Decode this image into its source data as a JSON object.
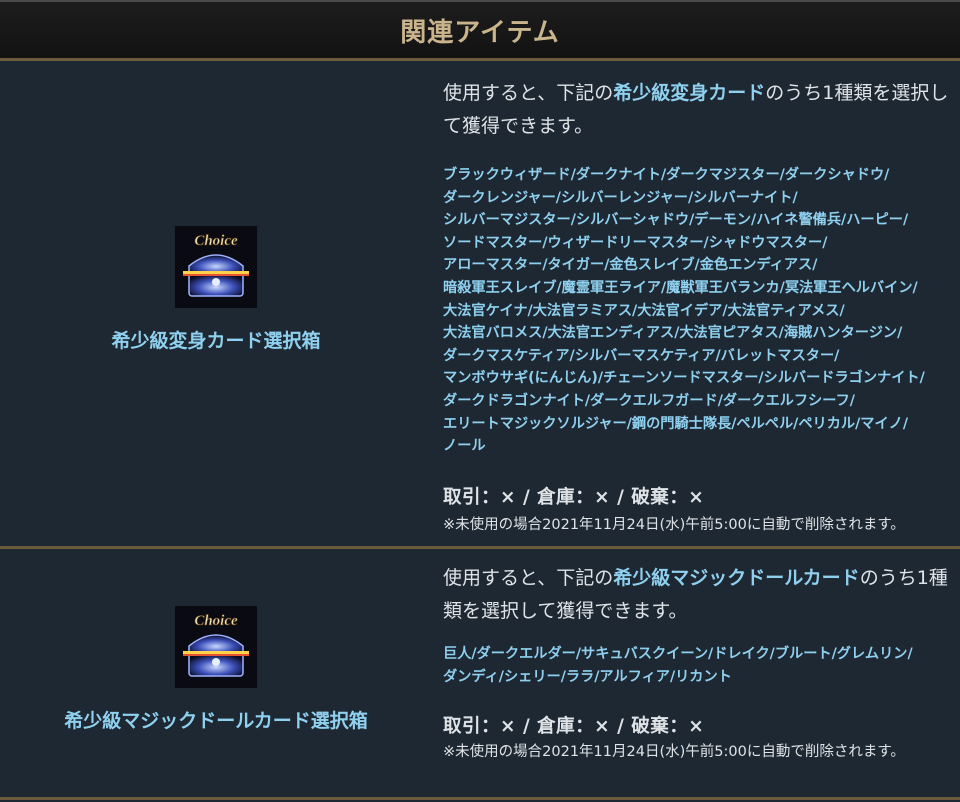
{
  "header": {
    "title": "関連アイテム"
  },
  "items": [
    {
      "badge": "Choice",
      "name": "希少級変身カード選択箱",
      "desc_pre": "使用すると、下記の",
      "desc_hl": "希少級変身カード",
      "desc_post": "のうち1種類を選択して獲得できます。",
      "list_lines": [
        "ブラックウィザード/ダークナイト/ダークマジスター/ダークシャドウ/",
        "ダークレンジャー/シルバーレンジャー/シルバーナイト/",
        "シルバーマジスター/シルバーシャドウ/デーモン/ハイネ警備兵/ハーピー/",
        "ソードマスター/ウィザードリーマスター/シャドウマスター/",
        "アローマスター/タイガー/金色スレイブ/金色エンディアス/",
        "暗殺軍王スレイブ/魔霊軍王ライア/魔獣軍王バランカ/冥法軍王ヘルバイン/",
        "大法官ケイナ/大法官ラミアス/大法官イデア/大法官ティアメス/",
        "大法官バロメス/大法官エンディアス/大法官ピアタス/海賊ハンタージン/",
        "ダークマスケティア/シルバーマスケティア/バレットマスター/",
        "マンボウサギ(にんじん)/チェーンソードマスター/シルバードラゴンナイト/",
        "ダークドラゴンナイト/ダークエルフガード/ダークエルフシーフ/",
        "エリートマジックソルジャー/鋼の門騎士隊長/ペルペル/ペリカル/マイノ/",
        "ノール"
      ],
      "trade": "取引：× / 倉庫：× / 破棄：×",
      "note": "※未使用の場合2021年11月24日(水)午前5:00に自動で削除されます。"
    },
    {
      "badge": "Choice",
      "name": "希少級マジックドールカード選択箱",
      "desc_pre": "使用すると、下記の",
      "desc_hl": "希少級マジックドールカード",
      "desc_post": "のうち1種類を選択して獲得できます。",
      "list_lines": [
        "巨人/ダークエルダー/サキュバスクイーン/ドレイク/ブルート/グレムリン/",
        "ダンディ/シェリー/ララ/アルフィア/リカント"
      ],
      "trade": "取引：× / 倉庫：× / 破棄：×",
      "note": "※未使用の場合2021年11月24日(水)午前5:00に自動で削除されます。"
    }
  ],
  "colors": {
    "accent": "#8fd0ef",
    "header_text": "#c9b48c",
    "border": "#6b5a3c",
    "bg": "#1e2833"
  },
  "icons": [
    "treasure-chest-icon"
  ]
}
